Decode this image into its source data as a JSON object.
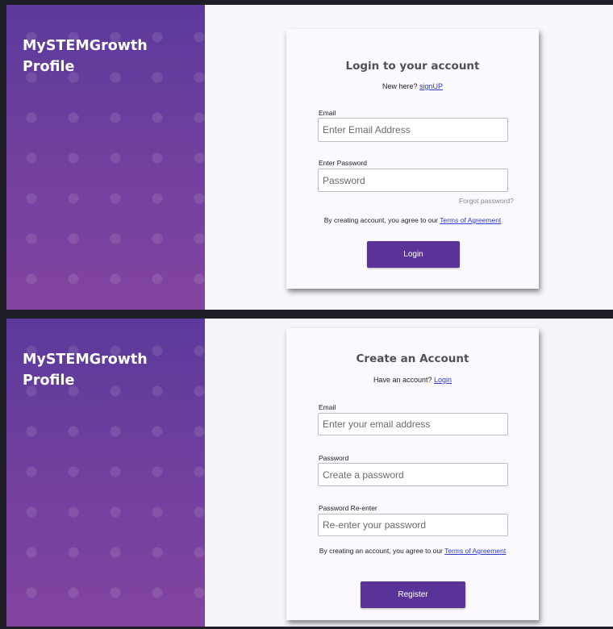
{
  "brand": {
    "line1": "MySTEMGrowth",
    "line2": "Profile"
  },
  "login": {
    "title": "Login to your account",
    "prompt": "New here?",
    "prompt_link": "signUP",
    "email_label": "Email",
    "email_placeholder": "Enter Email Address",
    "password_label": "Enter Password",
    "password_placeholder": "Password",
    "forgot": "Forgot password?",
    "terms_text": "By creating account, you agree to our",
    "terms_link": "Terms of Agreement",
    "button": "Login"
  },
  "register": {
    "title": "Create an Account",
    "prompt": "Have an account?",
    "prompt_link": "Login",
    "email_label": "Email",
    "email_placeholder": "Enter your email address",
    "password_label": "Password",
    "password_placeholder": "Create a password",
    "reenter_label": "Password Re-enter",
    "reenter_placeholder": "Re-enter your password",
    "terms_text": "By creating an account, you agree to our",
    "terms_link": "Terms of Agreement",
    "button": "Register"
  },
  "colors": {
    "accent": "#5a3399",
    "link": "#2f3fd0",
    "panel_top": "#5b3a9b",
    "panel_bottom": "#83449f"
  }
}
